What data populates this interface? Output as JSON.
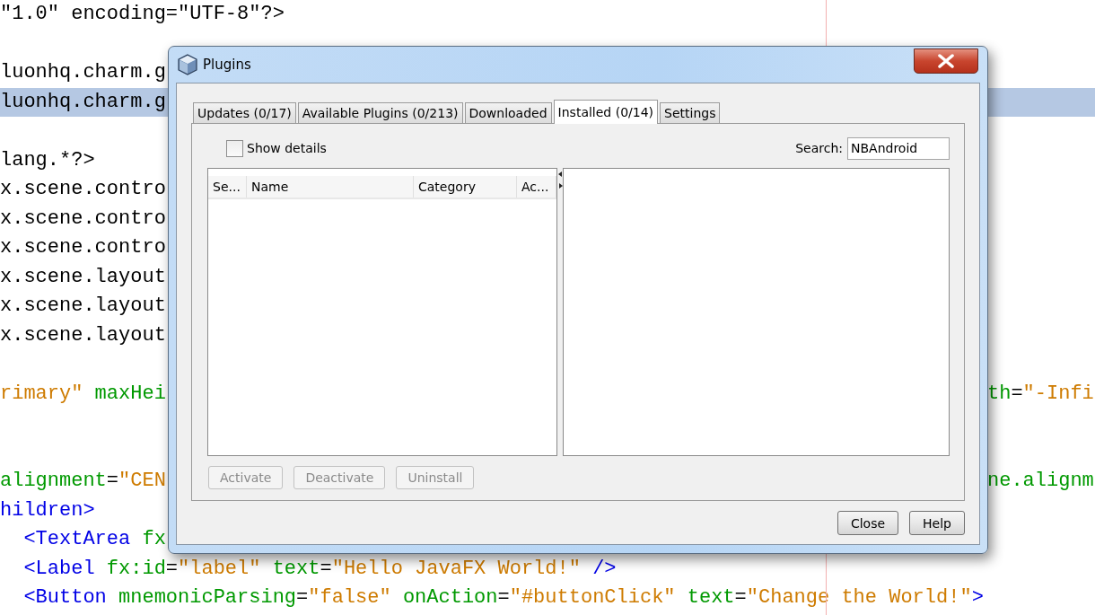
{
  "editor": {
    "lines": [
      {
        "highlighted": false,
        "left": [
          {
            "kind": "plain",
            "text": "\"1.0\" encoding=\"UTF-8\"?>"
          }
        ]
      },
      {
        "highlighted": false
      },
      {
        "highlighted": false,
        "left": [
          {
            "kind": "plain",
            "text": "luonhq.charm.g"
          }
        ]
      },
      {
        "highlighted": true,
        "left": [
          {
            "kind": "plain",
            "text": "luonhq.charm.g"
          }
        ]
      },
      {
        "highlighted": false
      },
      {
        "highlighted": false,
        "left": [
          {
            "kind": "plain",
            "text": "lang.*?>"
          }
        ]
      },
      {
        "highlighted": false,
        "left": [
          {
            "kind": "plain",
            "text": "x.scene.contro"
          }
        ]
      },
      {
        "highlighted": false,
        "left": [
          {
            "kind": "plain",
            "text": "x.scene.contro"
          }
        ]
      },
      {
        "highlighted": false,
        "left": [
          {
            "kind": "plain",
            "text": "x.scene.contro"
          }
        ]
      },
      {
        "highlighted": false,
        "left": [
          {
            "kind": "plain",
            "text": "x.scene.layout"
          }
        ]
      },
      {
        "highlighted": false,
        "left": [
          {
            "kind": "plain",
            "text": "x.scene.layout"
          }
        ]
      },
      {
        "highlighted": false,
        "left": [
          {
            "kind": "plain",
            "text": "x.scene.layout"
          }
        ]
      },
      {
        "highlighted": false
      },
      {
        "highlighted": false,
        "left": [
          {
            "kind": "value",
            "text": "rimary\""
          },
          {
            "kind": "attr",
            "text": " maxHei"
          }
        ],
        "right": [
          {
            "kind": "attr",
            "text": "th"
          },
          {
            "kind": "plain",
            "text": "="
          },
          {
            "kind": "value",
            "text": "\"-Infi"
          }
        ]
      },
      {
        "highlighted": false
      },
      {
        "highlighted": false
      },
      {
        "highlighted": false,
        "left": [
          {
            "kind": "attr",
            "text": "alignment"
          },
          {
            "kind": "plain",
            "text": "="
          },
          {
            "kind": "value",
            "text": "\"CEN"
          }
        ],
        "right": [
          {
            "kind": "attr",
            "text": "ne.alignm"
          }
        ]
      },
      {
        "highlighted": false,
        "left": [
          {
            "kind": "tag",
            "text": "hildren>"
          }
        ]
      },
      {
        "highlighted": false,
        "left": [
          {
            "kind": "tag",
            "text": "  <TextArea"
          },
          {
            "kind": "attr",
            "text": " fx"
          }
        ]
      },
      {
        "highlighted": false,
        "left": [
          {
            "kind": "tag",
            "text": "  <Label"
          },
          {
            "kind": "attr",
            "text": " fx:id"
          },
          {
            "kind": "plain",
            "text": "="
          },
          {
            "kind": "value",
            "text": "\"label\""
          },
          {
            "kind": "attr",
            "text": " text"
          },
          {
            "kind": "plain",
            "text": "="
          },
          {
            "kind": "value",
            "text": "\"Hello JavaFX World!\""
          },
          {
            "kind": "tag",
            "text": " />"
          }
        ]
      },
      {
        "highlighted": false,
        "left": [
          {
            "kind": "tag",
            "text": "  <Button"
          },
          {
            "kind": "attr",
            "text": " mnemonicParsing"
          },
          {
            "kind": "plain",
            "text": "="
          },
          {
            "kind": "value",
            "text": "\"false\""
          },
          {
            "kind": "attr",
            "text": " onAction"
          },
          {
            "kind": "plain",
            "text": "="
          },
          {
            "kind": "value",
            "text": "\"#buttonClick\""
          },
          {
            "kind": "attr",
            "text": " text"
          },
          {
            "kind": "plain",
            "text": "="
          },
          {
            "kind": "value",
            "text": "\"Change the World!\""
          },
          {
            "kind": "tag",
            "text": ">"
          }
        ]
      }
    ]
  },
  "dialog": {
    "title": "Plugins",
    "tabs": [
      {
        "label": "Updates (0/17)",
        "selected": false
      },
      {
        "label": "Available Plugins (0/213)",
        "selected": false
      },
      {
        "label": "Downloaded",
        "selected": false
      },
      {
        "label": "Installed (0/14)",
        "selected": true
      },
      {
        "label": "Settings",
        "selected": false
      }
    ],
    "show_details": {
      "label": "Show details",
      "checked": false
    },
    "search": {
      "label": "Search:",
      "value": "NBAndroid"
    },
    "table": {
      "columns": [
        "Se...",
        "Name",
        "Category",
        "Ac..."
      ]
    },
    "actions": [
      {
        "label": "Activate",
        "disabled": true
      },
      {
        "label": "Deactivate",
        "disabled": true
      },
      {
        "label": "Uninstall",
        "disabled": true
      }
    ],
    "buttons": [
      "Close",
      "Help"
    ]
  }
}
